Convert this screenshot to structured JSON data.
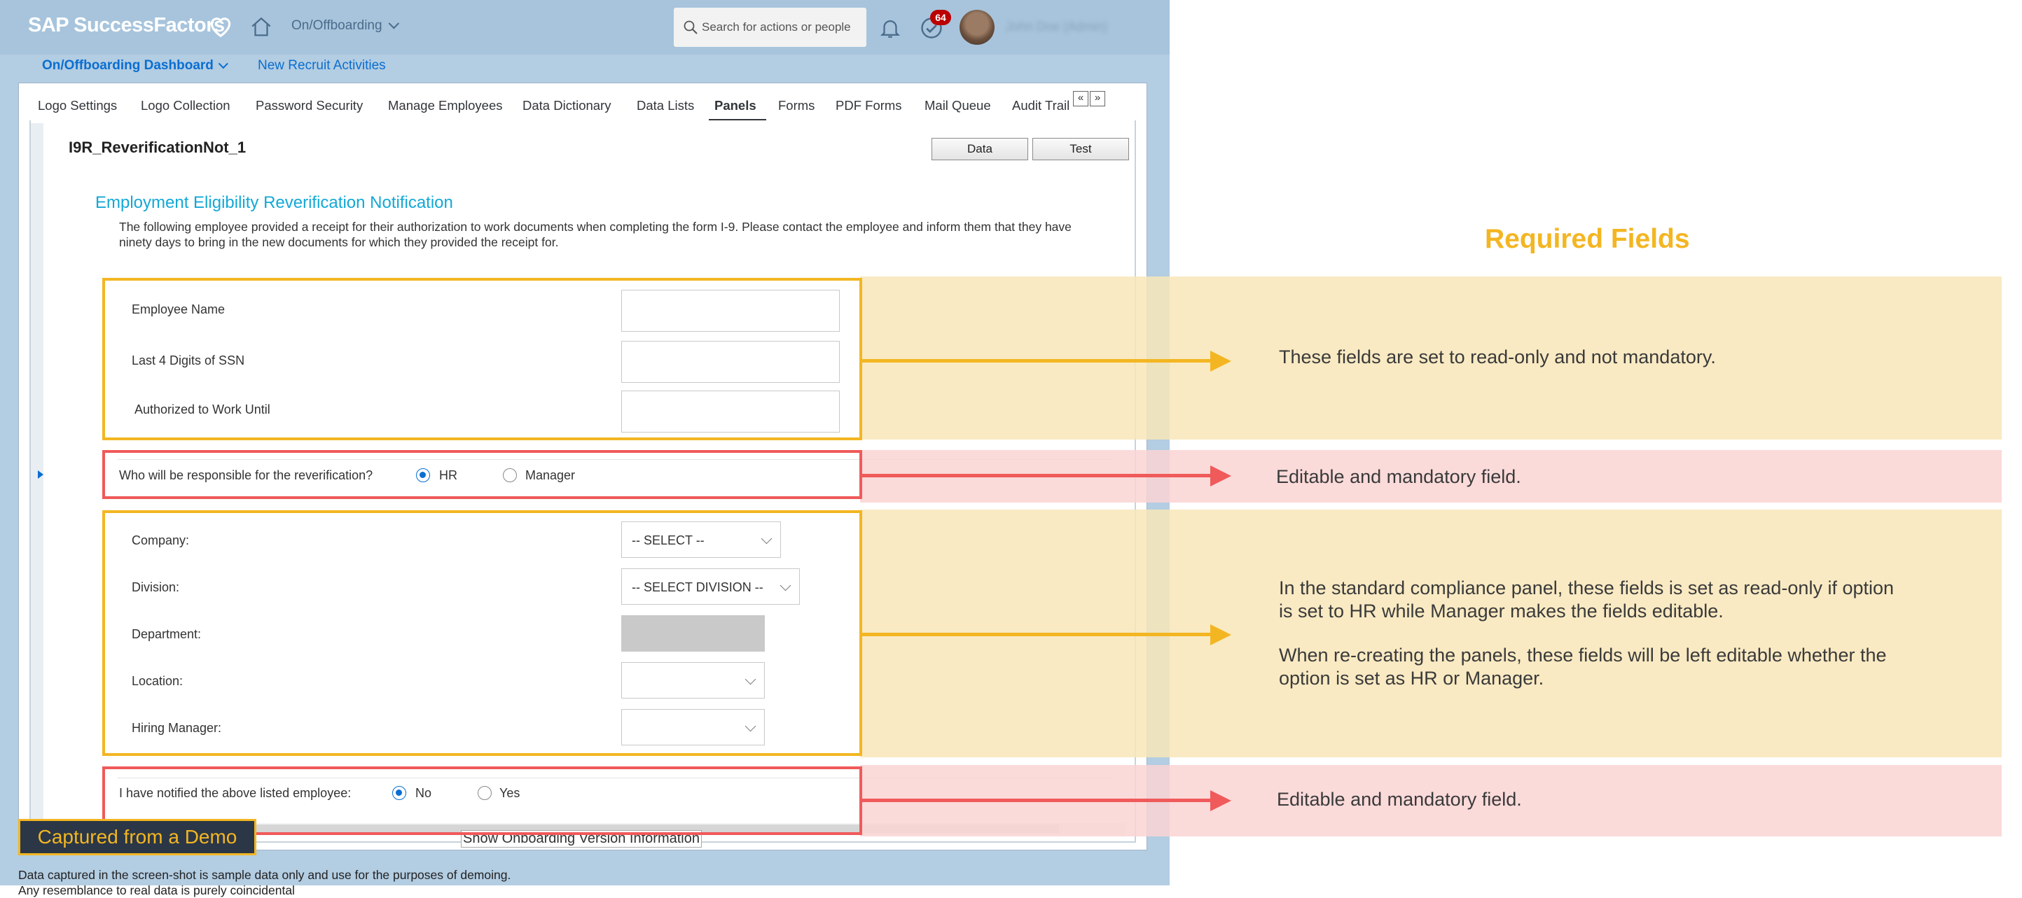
{
  "shell": {
    "brand": "SAP SuccessFactors",
    "module": "On/Offboarding",
    "search_placeholder": "Search for actions or people",
    "todo_count": "64",
    "user_name": "John Doe (Admin)"
  },
  "subnav": {
    "dashboard": "On/Offboarding Dashboard",
    "new_recruit": "New Recruit Activities"
  },
  "tabs": [
    "Logo Settings",
    "Logo Collection",
    "Password Security",
    "Manage Employees",
    "Data Dictionary",
    "Data Lists",
    "Panels",
    "Forms",
    "PDF Forms",
    "Mail Queue",
    "Audit Trail"
  ],
  "active_tab": "Panels",
  "tab_scroll": {
    "left": "«",
    "right": "»"
  },
  "panel": {
    "name": "I9R_ReverificationNot_1",
    "data_button": "Data",
    "test_button": "Test",
    "heading": "Employment Eligibility Reverification Notification",
    "intro": "The following employee provided a receipt for their authorization to work documents when completing the form I-9. Please contact the employee and inform them that they have ninety days to bring in the new documents for which they provided the receipt for.",
    "fields": {
      "employee_name": "Employee Name",
      "ssn": "Last 4 Digits of SSN",
      "authorized_until": "Authorized to Work Until"
    },
    "responsible": {
      "question": "Who will be responsible for the reverification?",
      "options": [
        "HR",
        "Manager"
      ],
      "selected": "HR"
    },
    "org": {
      "company_label": "Company:",
      "company_value": "-- SELECT --",
      "division_label": "Division:",
      "division_value": "-- SELECT DIVISION --",
      "department_label": "Department:",
      "location_label": "Location:",
      "hiring_manager_label": "Hiring Manager:"
    },
    "notified": {
      "question": "I have notified the above listed employee:",
      "options": [
        "No",
        "Yes"
      ],
      "selected": "No"
    },
    "version_link": "Show Onboarding Version Information"
  },
  "callouts": {
    "title": "Required Fields",
    "readonly_note": "These fields are set to read-only and not mandatory.",
    "editable_note_1": "Editable and mandatory field.",
    "org_note_1": "In the standard compliance panel, these fields is set as read-only if option is set to HR while Manager makes the fields editable.",
    "org_note_2": "When re-creating the panels, these fields will be left editable whether the option is set as HR or Manager.",
    "editable_note_2": "Editable and mandatory field.",
    "colors": {
      "yellow": "#f3b622",
      "red": "#f05a5a",
      "yellow_band": "#f8e6b8",
      "red_band": "#fad4d4"
    }
  },
  "demo": {
    "badge": "Captured from a Demo",
    "disclaimer_1": "Data captured in the screen-shot is sample data only and use for the purposes of demoing.",
    "disclaimer_2": "Any resemblance to real data is purely coincidental"
  }
}
